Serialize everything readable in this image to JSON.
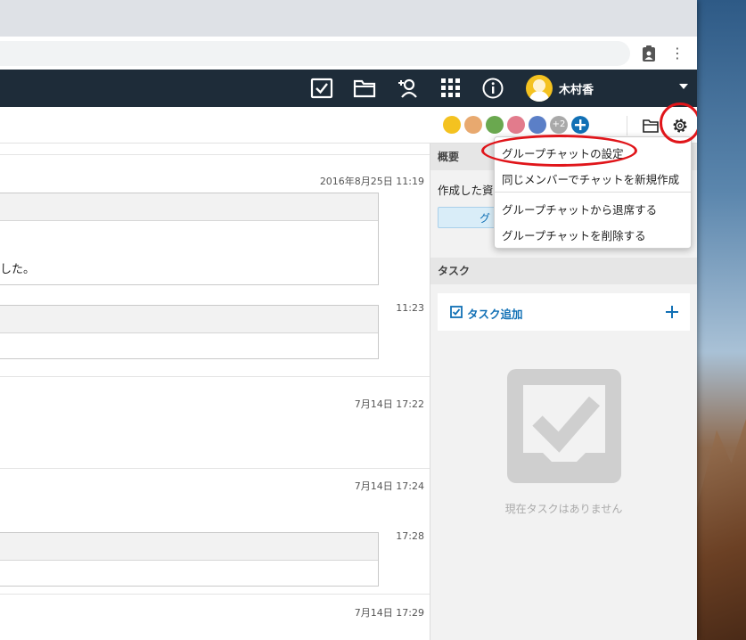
{
  "user": {
    "name": "木村香"
  },
  "avatars": {
    "more_count": "+2"
  },
  "overview": {
    "header": "概要",
    "created_label": "作成した資",
    "chip_text": "グ"
  },
  "tasks": {
    "header": "タスク",
    "add_label": "タスク追加",
    "empty_text": "現在タスクはありません"
  },
  "messages": [
    {
      "timestamp": "2016年8月25日 11:19",
      "body": "した。"
    },
    {
      "timestamp": "11:23"
    },
    {
      "timestamp": "7月14日 17:22"
    },
    {
      "timestamp": "7月14日 17:24"
    },
    {
      "timestamp": "17:28"
    },
    {
      "timestamp": "7月14日 17:29"
    }
  ],
  "menu": [
    {
      "label": "グループチャットの設定"
    },
    {
      "label": "同じメンバーでチャットを新規作成"
    },
    {
      "label": "グループチャットから退席する"
    },
    {
      "label": "グループチャットを削除する"
    }
  ],
  "colors": {
    "appbar": "#1e2c39",
    "accent": "#1170b5",
    "highlight": "#e0151a"
  },
  "icons": [
    "task-check-icon",
    "folder-icon",
    "add-contact-icon",
    "apps-grid-icon",
    "info-icon",
    "gear-icon",
    "plus-icon",
    "checkbox-icon"
  ]
}
